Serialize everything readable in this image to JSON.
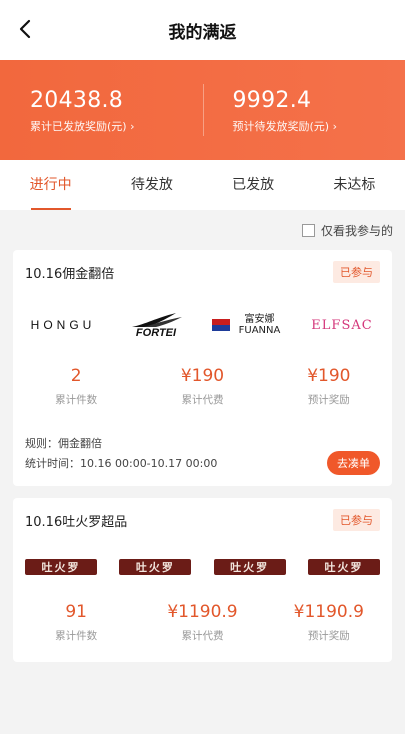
{
  "header": {
    "title": "我的满返",
    "back_icon": "chevron-left-icon"
  },
  "summary": {
    "issued_amount": "20438.8",
    "issued_label": "累计已发放奖励(元) ›",
    "pending_amount": "9992.4",
    "pending_label": "预计待发放奖励(元) ›",
    "color": "#f2683d"
  },
  "tabs": [
    {
      "label": "进行中",
      "active": true
    },
    {
      "label": "待发放"
    },
    {
      "label": "已发放"
    },
    {
      "label": "未达标"
    }
  ],
  "filter": {
    "label": "仅看我参与的"
  },
  "cards": [
    {
      "title": "10.16佣金翻倍",
      "badge": "已参与",
      "brands": [
        "HONGU",
        "FORTEI",
        "富安娜 FUANNA",
        "ELFSAC"
      ],
      "stats": [
        {
          "value": "2",
          "label": "累计件数"
        },
        {
          "value": "¥190",
          "label": "累计代费"
        },
        {
          "value": "¥190",
          "label": "预计奖励"
        }
      ],
      "rule": "规则：佣金翻倍",
      "time": "统计时间：10.16 00:00-10.17 00:00",
      "button": "去凑单"
    },
    {
      "title": "10.16吐火罗超品",
      "badge": "已参与",
      "brands": [
        "吐火罗",
        "吐火罗",
        "吐火罗",
        "吐火罗"
      ],
      "stats": [
        {
          "value": "91",
          "label": "累计件数"
        },
        {
          "value": "¥1190.9",
          "label": "累计代费"
        },
        {
          "value": "¥1190.9",
          "label": "预计奖励"
        }
      ]
    }
  ],
  "accent": "#e2572b"
}
